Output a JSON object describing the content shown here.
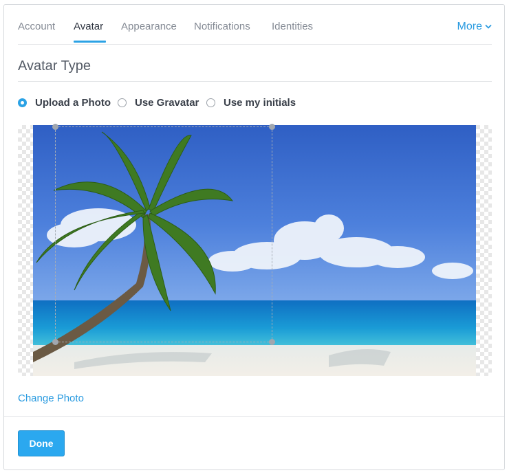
{
  "tabs": {
    "items": [
      {
        "label": "Account"
      },
      {
        "label": "Avatar"
      },
      {
        "label": "Appearance"
      },
      {
        "label": "Notifications"
      },
      {
        "label": "Identities"
      }
    ],
    "active": "Avatar",
    "more_label": "More",
    "more_icon": "chevron-down-icon"
  },
  "section": {
    "title": "Avatar Type"
  },
  "avatar_type": {
    "options": [
      {
        "label": "Upload a Photo",
        "selected": true
      },
      {
        "label": "Use Gravatar",
        "selected": false
      },
      {
        "label": "Use my initials",
        "selected": false
      }
    ]
  },
  "photo": {
    "change_label": "Change Photo"
  },
  "footer": {
    "done_label": "Done"
  },
  "colors": {
    "accent": "#2ba2e5",
    "link": "#2a9be0",
    "button": "#2ba8ef"
  }
}
